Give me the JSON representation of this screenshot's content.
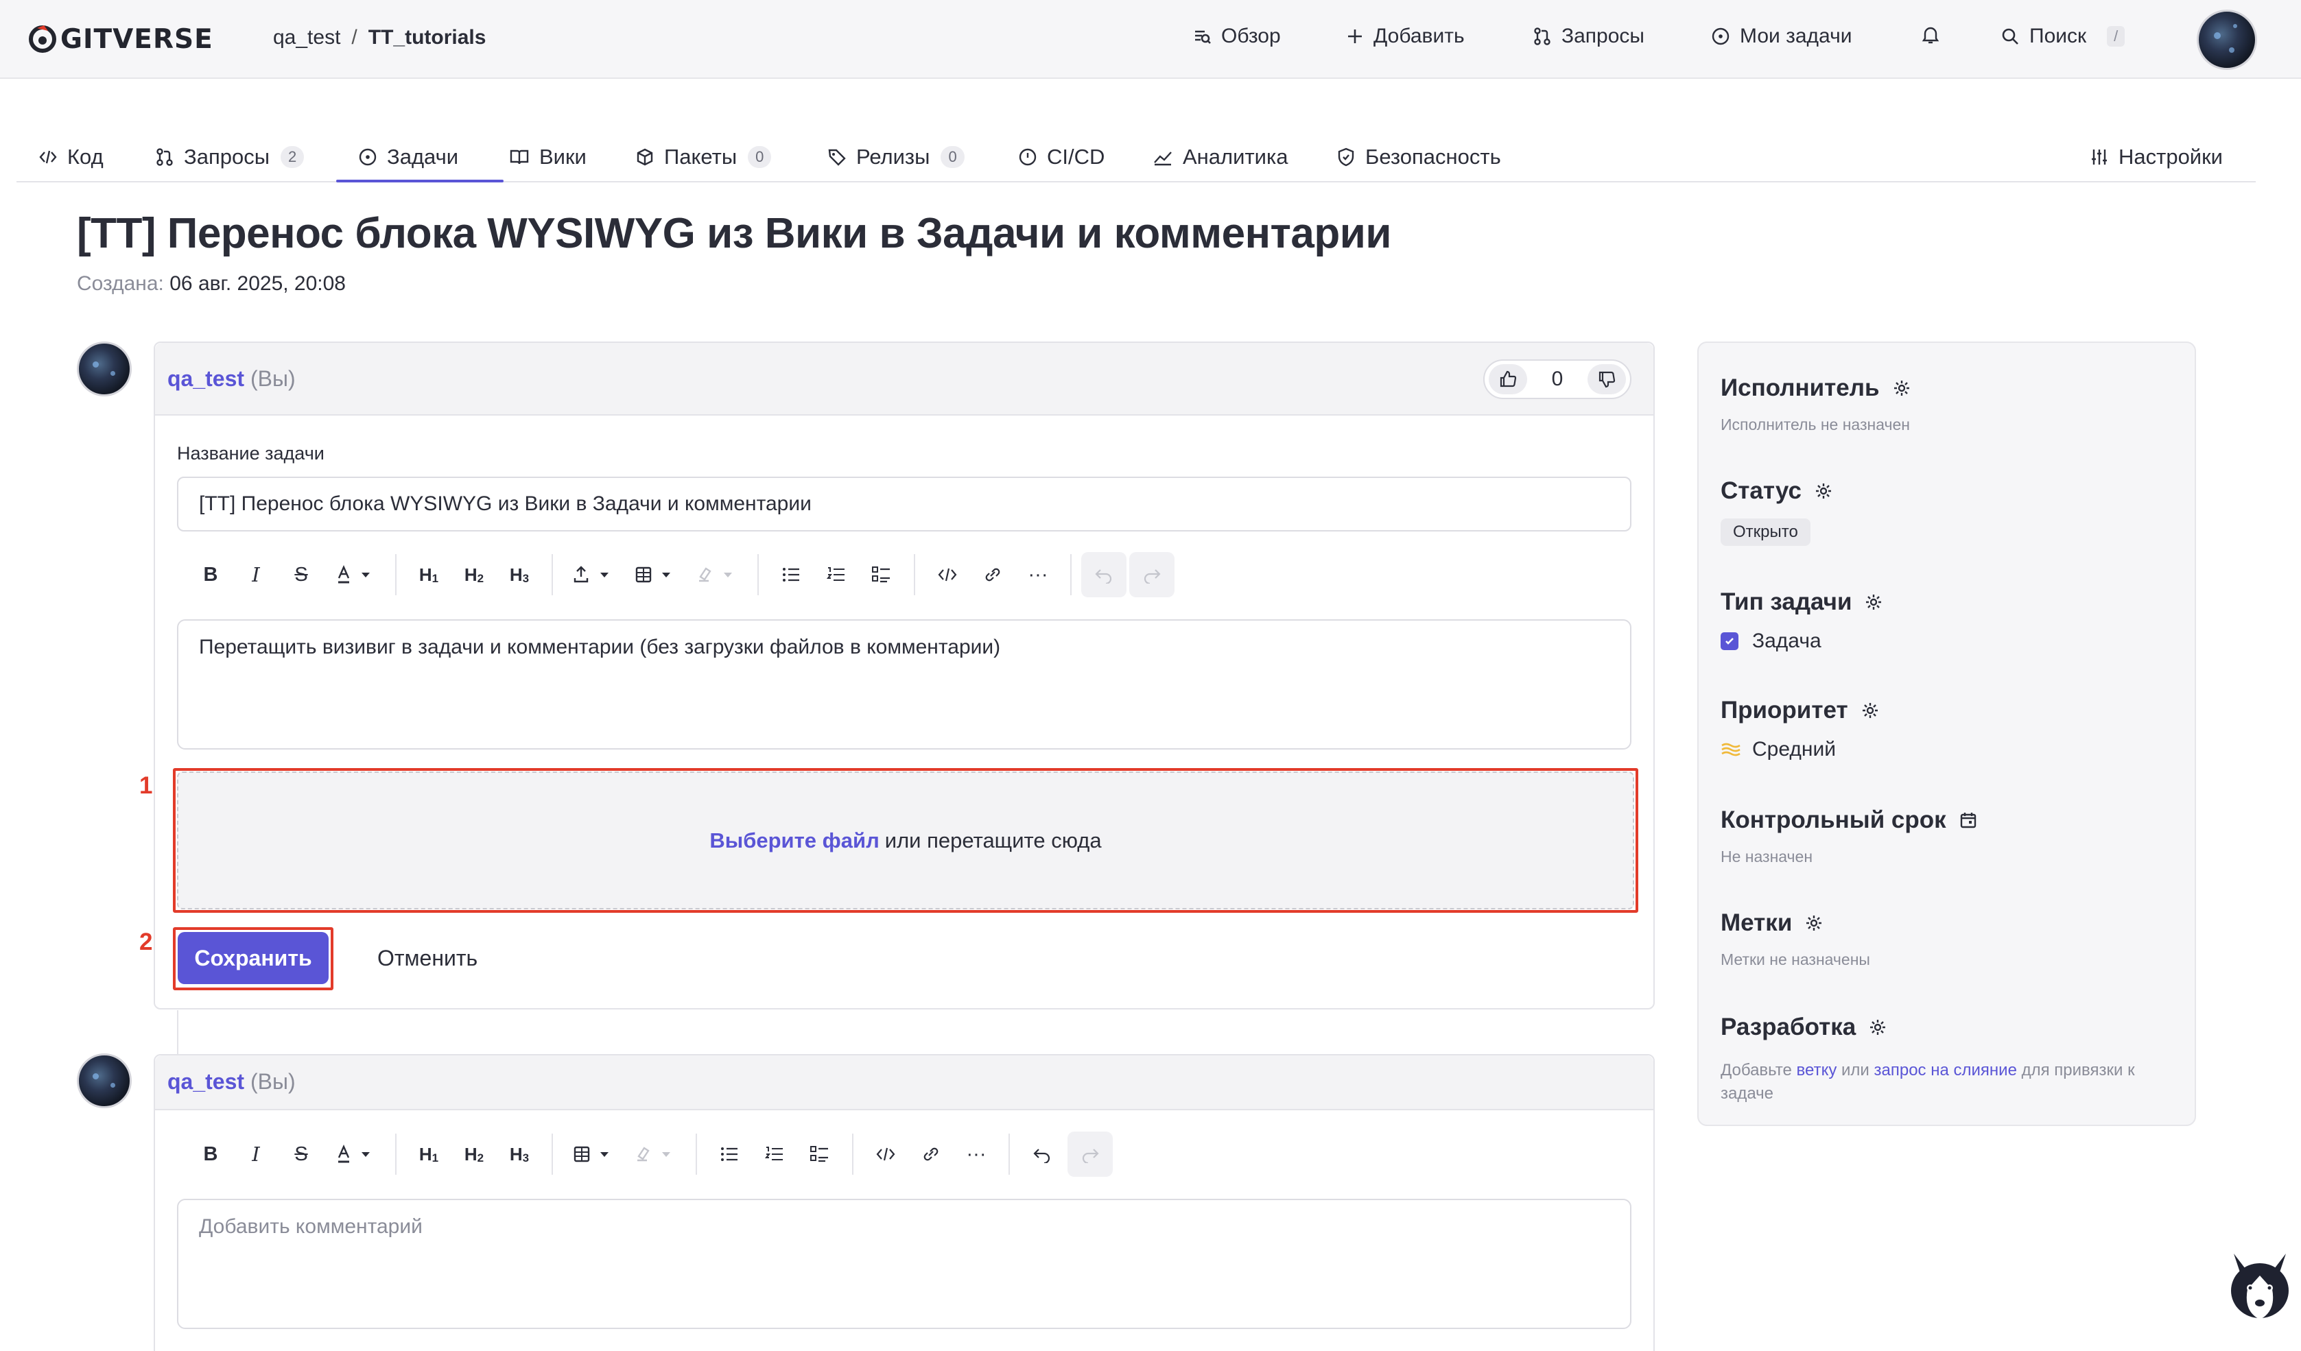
{
  "topbar": {
    "logo_text": "GITVERSE",
    "breadcrumb": {
      "owner": "qa_test",
      "separator": "/",
      "repo": "TT_tutorials"
    },
    "nav": {
      "overview": "Обзор",
      "add": "Добавить",
      "requests": "Запросы",
      "my_tasks": "Мои задачи",
      "search": "Поиск",
      "search_shortcut": "/"
    }
  },
  "tabs": [
    {
      "label": "Код"
    },
    {
      "label": "Запросы",
      "badge": "2"
    },
    {
      "label": "Задачи"
    },
    {
      "label": "Вики"
    },
    {
      "label": "Пакеты",
      "badge": "0"
    },
    {
      "label": "Релизы",
      "badge": "0"
    },
    {
      "label": "CI/CD"
    },
    {
      "label": "Аналитика"
    },
    {
      "label": "Безопасность"
    },
    {
      "label": "Настройки"
    }
  ],
  "issue": {
    "title": "[TT] Перенос блока WYSIWYG из Вики в Задачи и комментарии",
    "created_label": "Создана:",
    "created_value": "06 авг. 2025, 20:08"
  },
  "edit_card": {
    "author": "qa_test",
    "you_label": "(Вы)",
    "vote_count": "0",
    "name_label": "Название задачи",
    "name_value": "[TT] Перенос блока WYSIWYG из Вики в Задачи и комментарии",
    "body_text": "Перетащить визивиг в задачи и комментарии (без загрузки файлов в комментарии)",
    "dropzone_link": "Выберите файл",
    "dropzone_text": "или перетащите сюда",
    "save_button": "Сохранить",
    "cancel_button": "Отменить"
  },
  "toolbar": {
    "bold": "B",
    "italic": "I",
    "strike": "S",
    "h1": "H",
    "h2": "H",
    "h3": "H",
    "h1_sub": "1",
    "h2_sub": "2",
    "h3_sub": "3",
    "more": "···"
  },
  "annotations": {
    "marker_1": "1",
    "marker_2": "2",
    "color": "#e23b2a"
  },
  "comment_card": {
    "author": "qa_test",
    "you_label": "(Вы)",
    "placeholder": "Добавить комментарий"
  },
  "sidebar": {
    "assignee_title": "Исполнитель",
    "assignee_value": "Исполнитель не назначен",
    "status_title": "Статус",
    "status_value": "Открыто",
    "type_title": "Тип задачи",
    "type_value": "Задача",
    "priority_title": "Приоритет",
    "priority_value": "Средний",
    "deadline_title": "Контрольный срок",
    "deadline_value": "Не назначен",
    "labels_title": "Метки",
    "labels_value": "Метки не назначены",
    "dev_title": "Разработка",
    "dev_text_1": "Добавьте",
    "dev_link_branch": "ветку",
    "dev_text_2": "или",
    "dev_link_mr": "запрос на слияние",
    "dev_text_3": "для привязки к задаче"
  },
  "colors": {
    "accent": "#5a55d6",
    "annotation": "#e23b2a",
    "priority": "#f0b93a"
  }
}
